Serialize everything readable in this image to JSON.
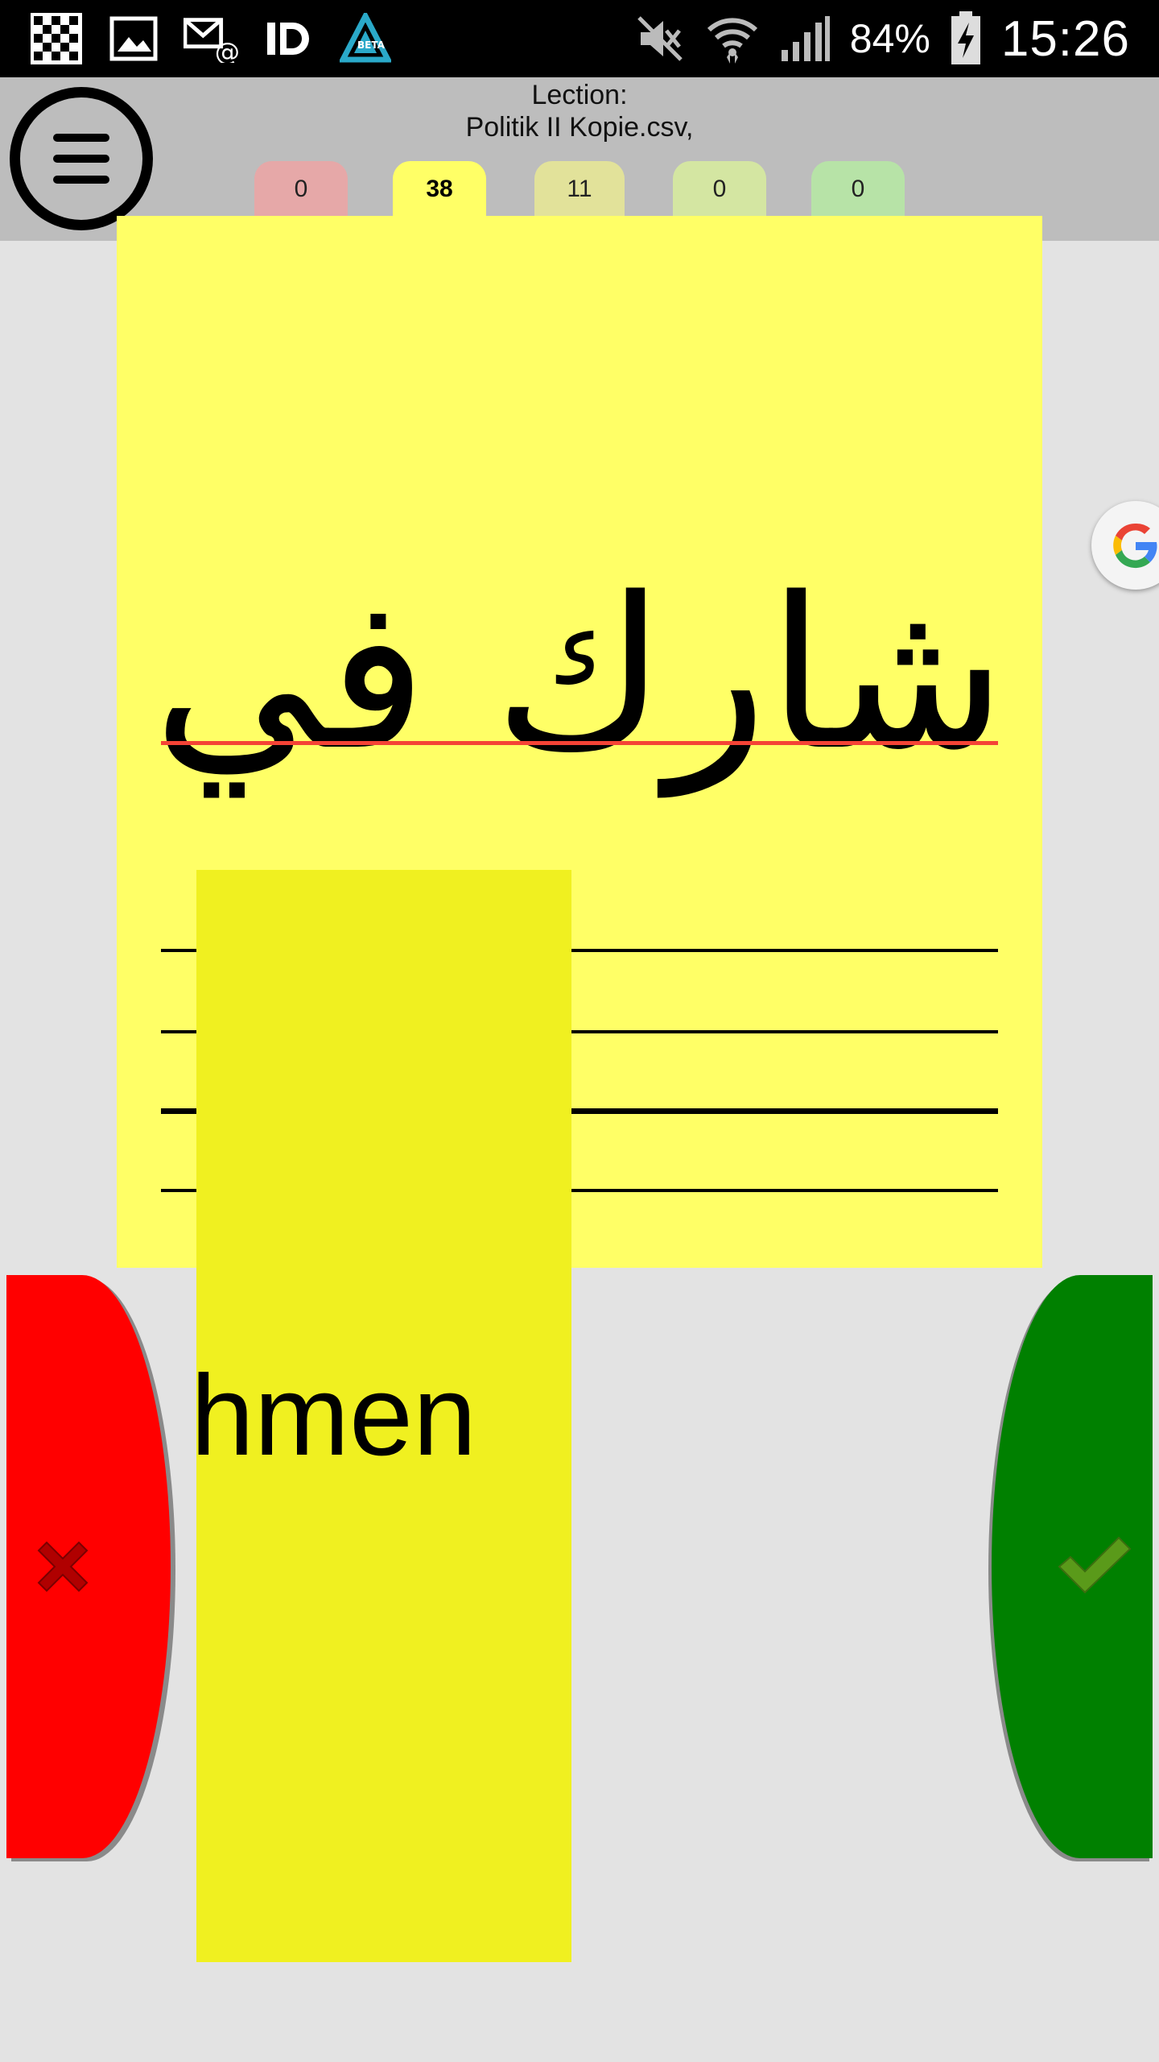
{
  "status_bar": {
    "left_icons": [
      "checkerboard-icon",
      "gallery-icon",
      "email-icon",
      "id-icon",
      "beta-app-icon"
    ],
    "right_icons": [
      "mute-icon",
      "wifi-icon",
      "signal-icon",
      "battery-charging-icon"
    ],
    "battery": "84%",
    "time": "15:26"
  },
  "header": {
    "lection_label": "Lection:",
    "lection_file": "Politik II Kopie.csv,",
    "menu_icon": "hamburger-menu-icon"
  },
  "box_tabs": [
    {
      "count": "0",
      "color": "#e6a8a8",
      "active": false
    },
    {
      "count": "38",
      "color": "#ffff66",
      "active": true
    },
    {
      "count": "11",
      "color": "#e2e29a",
      "active": false
    },
    {
      "count": "0",
      "color": "#d4e6a2",
      "active": false
    },
    {
      "count": "0",
      "color": "#b7e3a7",
      "active": false
    }
  ],
  "card": {
    "question": "شارك في",
    "color": "#ffff66"
  },
  "answer": {
    "visible_text": "hmen",
    "color": "#f0f020"
  },
  "buttons": {
    "wrong_icon": "cross-icon",
    "wrong_color": "#ff0000",
    "right_icon": "checkmark-icon",
    "right_color": "#008000"
  },
  "floating": {
    "icon": "google-g-icon"
  }
}
